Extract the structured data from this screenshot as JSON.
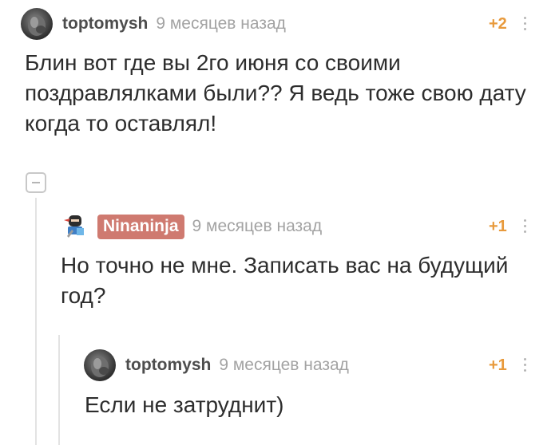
{
  "comments": [
    {
      "username": "toptomysh",
      "time": "9 месяцев назад",
      "rating": "+2",
      "text": "Блин вот где вы 2го июня со своими поздравлялками были?? Я ведь тоже свою дату когда то оставлял!"
    },
    {
      "username": "Ninaninja",
      "time": "9 месяцев назад",
      "rating": "+1",
      "text": "Но точно не мне. Записать вас на будущий год?"
    },
    {
      "username": "toptomysh",
      "time": "9 месяцев назад",
      "rating": "+1",
      "text": "Если не затруднит)"
    }
  ],
  "icons": {
    "collapse": "minus-square-icon",
    "more": "vertical-dots-icon",
    "avatar_toptomysh": "avatar-photo",
    "avatar_ninaninja": "ninja-avatar"
  },
  "colors": {
    "rating": "#e89a3c",
    "username_badge": "#cf7a70",
    "time": "#a3a3a3"
  }
}
